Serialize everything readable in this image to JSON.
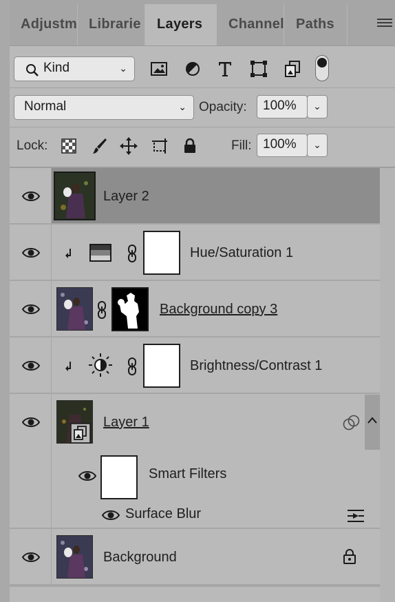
{
  "tabs": [
    "Adjustm",
    "Librarie",
    "Layers",
    "Channel",
    "Paths"
  ],
  "filter": {
    "kind_label": "Kind"
  },
  "blend": {
    "mode": "Normal",
    "opacity_label": "Opacity:",
    "opacity_value": "100%"
  },
  "lock": {
    "label": "Lock:",
    "fill_label": "Fill:",
    "fill_value": "100%"
  },
  "layers": [
    {
      "name": "Layer 2"
    },
    {
      "name": "Hue/Saturation 1"
    },
    {
      "name": "Background copy 3"
    },
    {
      "name": "Brightness/Contrast 1"
    },
    {
      "name": "Layer 1"
    },
    {
      "name": "Smart Filters"
    },
    {
      "name": "Surface Blur"
    },
    {
      "name": "Background"
    }
  ],
  "colors": {
    "selected_row": "#8d8d8d",
    "panel": "#bababa",
    "tabbar": "#a6a6a6"
  },
  "icons": [
    "eye-icon",
    "link-icon",
    "clip-arrow-icon",
    "lock-icon",
    "smart-object-icon",
    "filter-options-icon"
  ]
}
